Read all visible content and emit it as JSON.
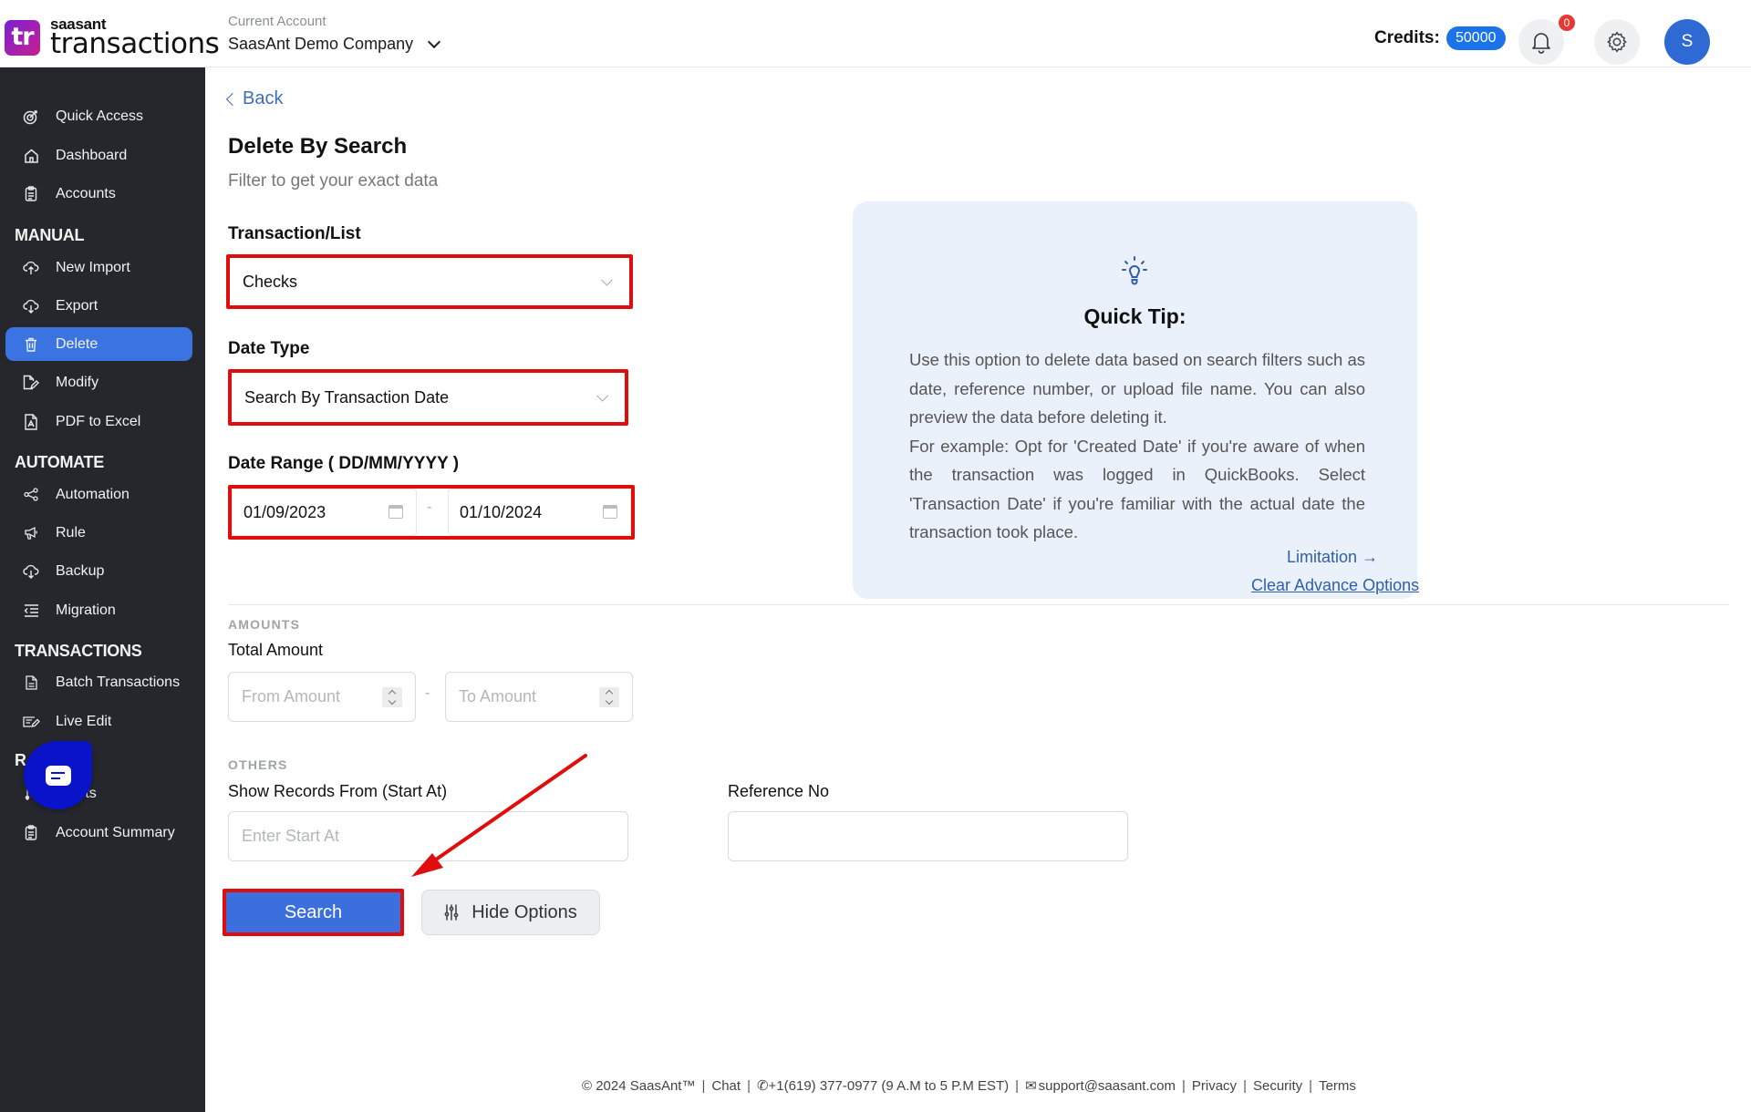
{
  "app": {
    "logo_brand": "saasant",
    "logo_product": "transactions",
    "logo_mark": "tr"
  },
  "header": {
    "account_label": "Current Account",
    "account_name": "SaasAnt Demo Company",
    "credits_label": "Credits:",
    "credits_value": "50000",
    "notification_count": "0",
    "avatar_initial": "S",
    "icons": [
      "chevron-down-icon",
      "bell-icon",
      "gear-icon"
    ]
  },
  "sidebar": {
    "items": [
      {
        "label": "Quick Access",
        "icon": "target-icon"
      },
      {
        "label": "Dashboard",
        "icon": "home-icon"
      },
      {
        "label": "Accounts",
        "icon": "clipboard-icon"
      },
      {
        "label": "New Import",
        "icon": "cloud-upload-icon"
      },
      {
        "label": "Export",
        "icon": "cloud-download-icon"
      },
      {
        "label": "Delete",
        "icon": "trash-icon",
        "active": true
      },
      {
        "label": "Modify",
        "icon": "file-edit-icon"
      },
      {
        "label": "PDF to Excel",
        "icon": "pdf-file-icon"
      },
      {
        "label": "Automation",
        "icon": "share-nodes-icon"
      },
      {
        "label": "Rule",
        "icon": "megaphone-icon"
      },
      {
        "label": "Backup",
        "icon": "cloud-download-icon"
      },
      {
        "label": "Migration",
        "icon": "list-indent-icon"
      },
      {
        "label": "Batch Transactions",
        "icon": "document-icon"
      },
      {
        "label": "Live Edit",
        "icon": "pencil-box-icon"
      },
      {
        "label": "...ts",
        "icon": "reports-icon"
      },
      {
        "label": "Account Summary",
        "icon": "clipboard-icon"
      }
    ],
    "sections": {
      "manual": "MANUAL",
      "automate": "AUTOMATE",
      "transactions": "TRANSACTIONS",
      "reports_partial": "R"
    }
  },
  "main": {
    "back_label": "Back",
    "title": "Delete By Search",
    "subtitle": "Filter to get your exact data",
    "transaction_list": {
      "label": "Transaction/List",
      "value": "Checks"
    },
    "date_type": {
      "label": "Date Type",
      "value": "Search By Transaction Date"
    },
    "date_range": {
      "label": "Date Range ( DD/MM/YYYY )",
      "from": "01/09/2023",
      "separator": "-",
      "to": "01/10/2024"
    },
    "amounts": {
      "section": "AMOUNTS",
      "label": "Total Amount",
      "from_placeholder": "From Amount",
      "separator": "-",
      "to_placeholder": "To Amount"
    },
    "others": {
      "section": "OTHERS",
      "start_at_label": "Show Records From (Start At)",
      "start_at_placeholder": "Enter Start At",
      "reference_label": "Reference No",
      "reference_value": ""
    },
    "search_button": "Search",
    "hide_options_button": "Hide Options"
  },
  "tip": {
    "title": "Quick Tip:",
    "body_line1": "Use this option to delete data based on search filters such as date, reference number, or upload file name. You can also preview the data before deleting it.",
    "body_line2": "For example: Opt for 'Created Date' if you're aware of when the transaction was logged in QuickBooks. Select 'Transaction Date' if you're familiar with the actual date the transaction took place.",
    "limitation_link": "Limitation",
    "clear_link": "Clear Advance Options"
  },
  "footer": {
    "copyright": "© 2024 SaasAnt™",
    "chat": "Chat",
    "phone": "+1(619) 377-0977 (9 A.M to 5 P.M EST)",
    "email": "support@saasant.com",
    "privacy": "Privacy",
    "security": "Security",
    "terms": "Terms"
  },
  "colors": {
    "accent": "#3b74e0",
    "sidebar_bg": "#25272d",
    "highlight": "#e00d0d",
    "credits_badge": "#1a73e8",
    "tip_bg": "#ebf1fb"
  }
}
